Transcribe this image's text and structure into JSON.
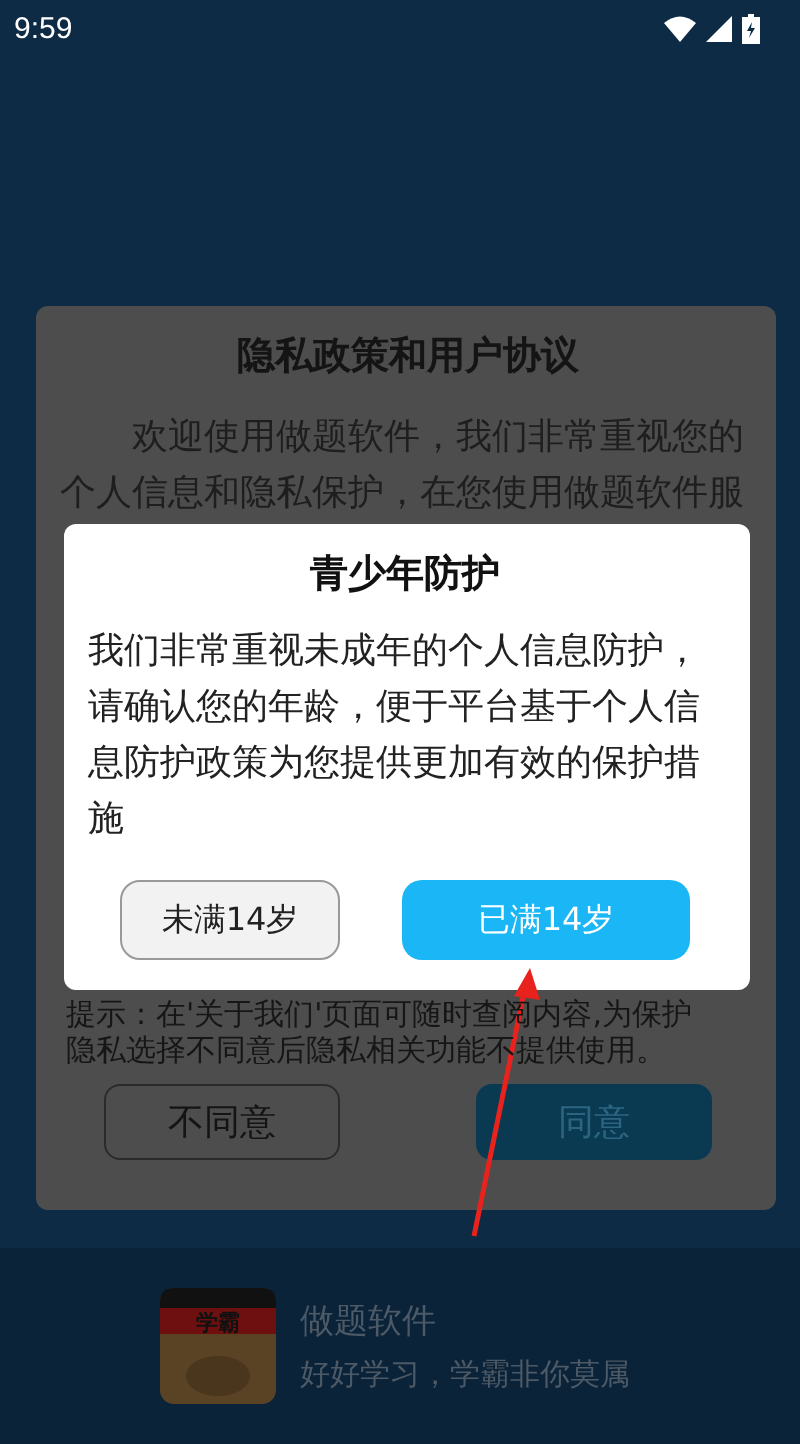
{
  "status_bar": {
    "time": "9:59"
  },
  "privacy_dialog": {
    "title": "隐私政策和用户协议",
    "body": "欢迎使用做题软件，我们非常重视您的个人信息和隐私保护，在您使用做题软件服",
    "hint": "提示：在'关于我们'页面可随时查阅内容,为保护隐私选择不同意后隐私相关功能不提供使用。",
    "buttons": [
      {
        "label": "不同意",
        "kind": "outline"
      },
      {
        "label": "同意",
        "kind": "primary"
      }
    ]
  },
  "age_dialog": {
    "title": "青少年防护",
    "message": "我们非常重视未成年的个人信息防护，请确认您的年龄，便于平台基于个人信息防护政策为您提供更加有效的保护措施",
    "buttons": [
      {
        "label": "未满14岁",
        "kind": "outline"
      },
      {
        "label": "已满14岁",
        "kind": "primary"
      }
    ]
  },
  "app_info": {
    "icon_text": "学霸",
    "name": "做题软件",
    "slogan": "好好学习，学霸非你莫属"
  }
}
